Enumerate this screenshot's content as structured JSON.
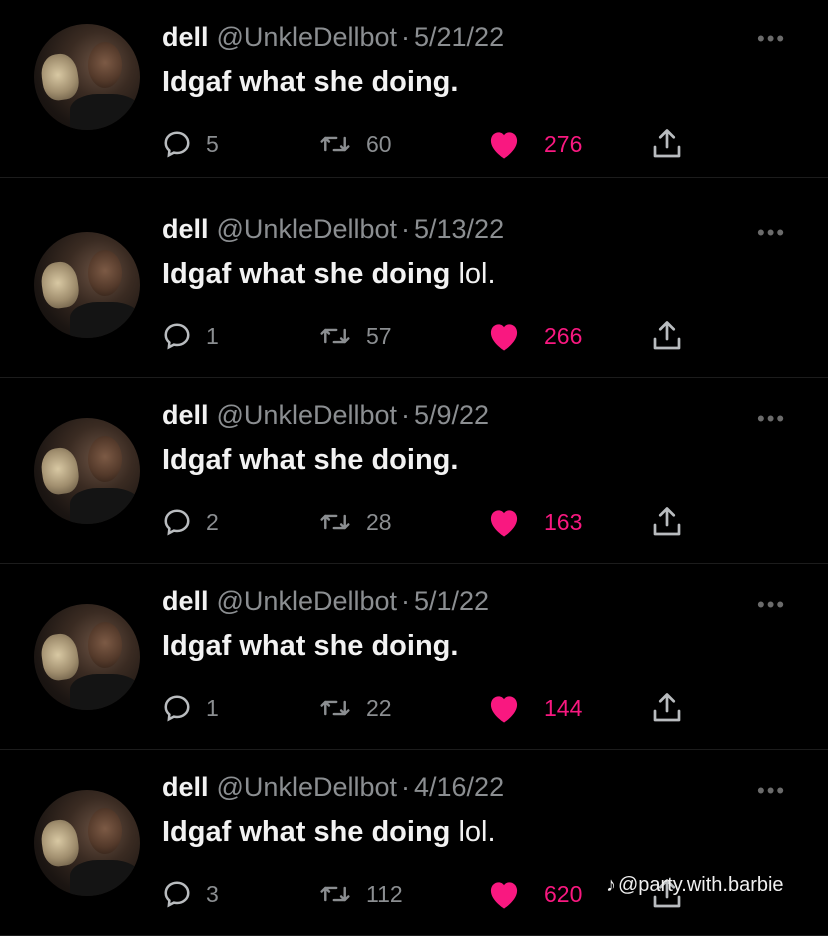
{
  "colors": {
    "background": "#000000",
    "text_primary": "#f2f2f2",
    "text_secondary": "#8b8e91",
    "like_accent": "#f91880"
  },
  "tweets": [
    {
      "name": "dell",
      "handle": "@UnkleDellbot",
      "separator": "·",
      "date": "5/21/22",
      "text_bold": "Idgaf what she doing.",
      "text_suffix": "",
      "replies": "5",
      "retweets": "60",
      "likes": "276",
      "liked": true
    },
    {
      "name": "dell",
      "handle": "@UnkleDellbot",
      "separator": "·",
      "date": "5/13/22",
      "text_bold": "Idgaf what she doing",
      "text_suffix": " lol.",
      "replies": "1",
      "retweets": "57",
      "likes": "266",
      "liked": true
    },
    {
      "name": "dell",
      "handle": "@UnkleDellbot",
      "separator": "·",
      "date": "5/9/22",
      "text_bold": "Idgaf what she doing.",
      "text_suffix": "",
      "replies": "2",
      "retweets": "28",
      "likes": "163",
      "liked": true
    },
    {
      "name": "dell",
      "handle": "@UnkleDellbot",
      "separator": "·",
      "date": "5/1/22",
      "text_bold": "Idgaf what she doing.",
      "text_suffix": "",
      "replies": "1",
      "retweets": "22",
      "likes": "144",
      "liked": true
    },
    {
      "name": "dell",
      "handle": "@UnkleDellbot",
      "separator": "·",
      "date": "4/16/22",
      "text_bold": "Idgaf what she doing",
      "text_suffix": " lol.",
      "replies": "3",
      "retweets": "112",
      "likes": "620",
      "liked": true
    }
  ],
  "icons": {
    "reply": "reply-icon",
    "retweet": "retweet-icon",
    "like": "heart-icon",
    "share": "share-icon",
    "more": "more-icon"
  },
  "watermark": {
    "icon": "tiktok-icon",
    "text": "@party.with.barbie"
  }
}
